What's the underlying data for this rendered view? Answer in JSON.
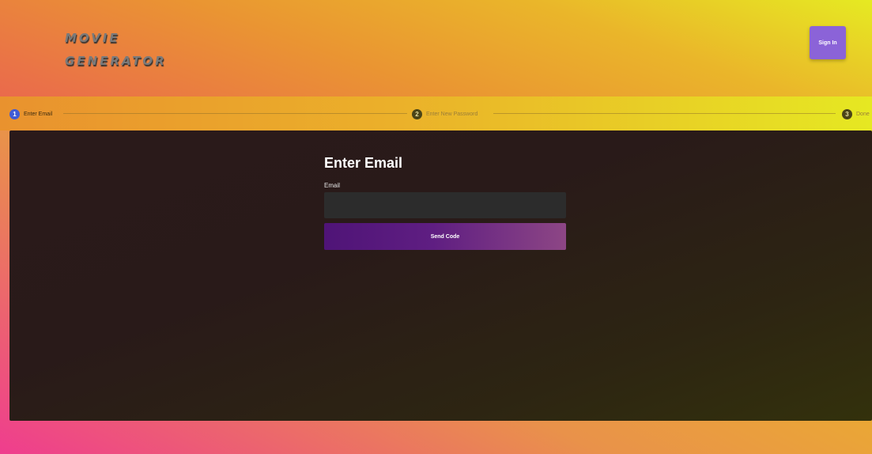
{
  "app": {
    "logo_line1": "MOVIE",
    "logo_line2": "GENERATOR"
  },
  "header": {
    "signin_label": "Sign In"
  },
  "stepper": {
    "steps": [
      {
        "number": "1",
        "label": "Enter Email",
        "state": "active"
      },
      {
        "number": "2",
        "label": "Enter New Password",
        "state": "inactive"
      },
      {
        "number": "3",
        "label": "Done",
        "state": "inactive"
      }
    ]
  },
  "form": {
    "title": "Enter Email",
    "email_label": "Email",
    "email_value": "",
    "email_placeholder": "",
    "send_label": "Send Code"
  },
  "colors": {
    "accent_active_step": "#3f5bd6",
    "signin_button": "#8b63d8",
    "send_button_start": "#4f1477",
    "send_button_end": "#8d4685",
    "panel_background": "#2a1a1a"
  }
}
